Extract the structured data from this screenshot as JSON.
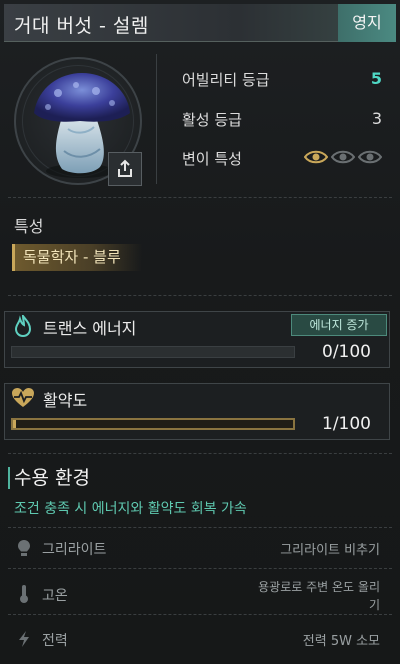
{
  "header": {
    "title": "거대 버섯 - 설렘",
    "tag": "영지"
  },
  "stats": [
    {
      "label": "어빌리티 등급",
      "value": "5"
    },
    {
      "label": "활성 등급",
      "value": "3"
    },
    {
      "label": "변이 특성"
    }
  ],
  "mutation_eyes": {
    "active": 1,
    "total": 3
  },
  "trait": {
    "section_label": "특성",
    "chip": "독물학자 - 블루"
  },
  "trans_energy": {
    "label": "트랜스 에너지",
    "boost_button": "에너지 증가",
    "count": "0/100",
    "progress": 0
  },
  "vitality": {
    "label": "활약도",
    "count": "1/100",
    "progress": 0.01
  },
  "environment": {
    "title": "수용 환경",
    "subtitle": "조건 충족 시 에너지와 활약도 회복 가속",
    "rows": [
      {
        "icon": "bulb-icon",
        "name": "그리라이트",
        "condition": "그리라이트 비추기"
      },
      {
        "icon": "thermometer-icon",
        "name": "고온",
        "condition": "용광로로 주변 온도 올리기"
      },
      {
        "icon": "lightning-icon",
        "name": "전력",
        "condition": "전력 5W 소모"
      }
    ]
  },
  "colors": {
    "accent": "#4fd8c5",
    "gold": "#c9a75a",
    "teal_button": "#294a43"
  }
}
